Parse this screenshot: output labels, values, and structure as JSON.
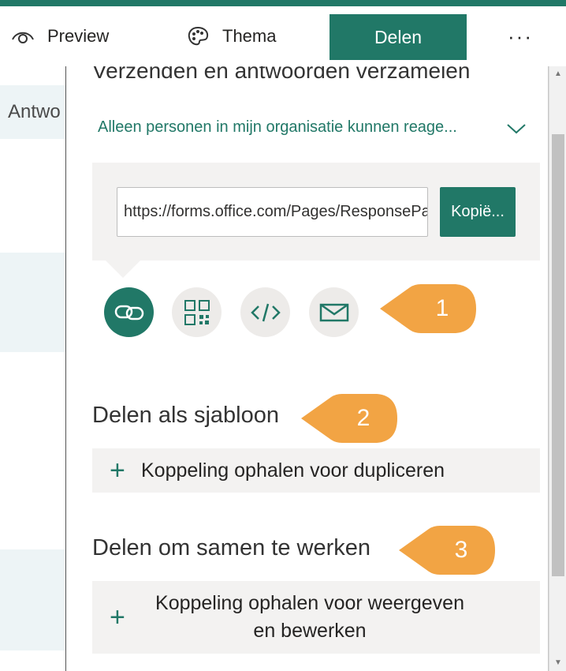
{
  "commandbar": {
    "preview_label": "Preview",
    "theme_label": "Thema",
    "share_label": "Delen",
    "more_label": "···"
  },
  "background": {
    "tab_partial": "Antwo"
  },
  "panel": {
    "title": "Verzenden en antwoorden verzamelen",
    "audience": "Alleen personen in mijn organisatie kunnen reage...",
    "link_value": "https://forms.office.com/Pages/ResponsePage.aspx",
    "copy_label": "Kopië...",
    "share_methods": [
      "link-icon",
      "qr-code-icon",
      "embed-code-icon",
      "mail-icon"
    ],
    "template_title": "Delen als sjabloon",
    "template_action": "Koppeling ophalen voor dupliceren",
    "collab_title": "Delen om samen te werken",
    "collab_action_line1": "Koppeling ophalen voor weergeven",
    "collab_action_line2": "en bewerken"
  },
  "callouts": [
    "1",
    "2",
    "3"
  ],
  "colors": {
    "accent": "#217867",
    "callout": "#F2A444",
    "panel_gray": "#F3F2F1"
  }
}
